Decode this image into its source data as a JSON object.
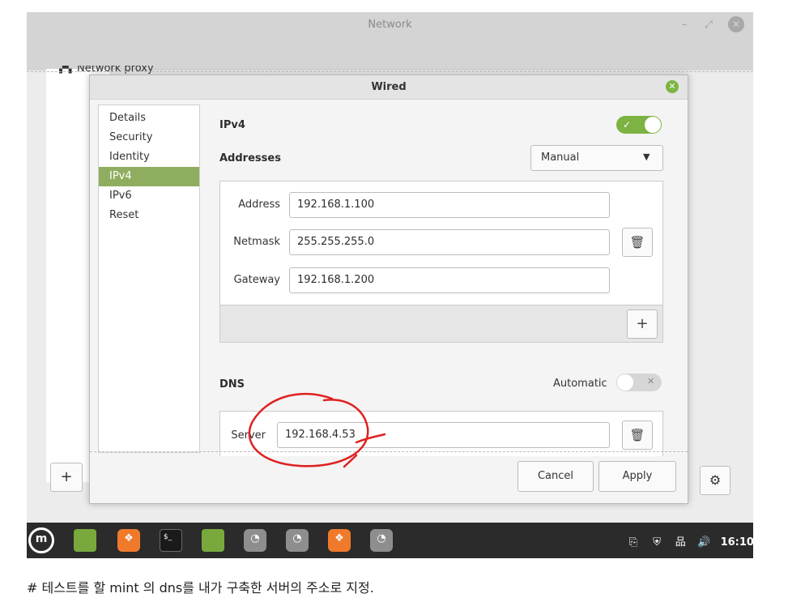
{
  "network_window": {
    "title": "Network",
    "proxy_label": "Network proxy",
    "minimize_glyph": "–",
    "maximize_glyph": "⤢",
    "close_glyph": "✕",
    "add_glyph": "+",
    "gear_glyph": "⚙"
  },
  "wired_dialog": {
    "title": "Wired",
    "close_glyph": "✕",
    "nav": [
      "Details",
      "Security",
      "Identity",
      "IPv4",
      "IPv6",
      "Reset"
    ],
    "active_nav": "IPv4",
    "ipv4_label": "IPv4",
    "ipv4_enabled": true,
    "ipv4_toggle_glyph": "✓",
    "addresses_label": "Addresses",
    "method": {
      "selected": "Manual",
      "caret": "▼"
    },
    "address": {
      "label": "Address",
      "value": "192.168.1.100"
    },
    "netmask": {
      "label": "Netmask",
      "value": "255.255.255.0"
    },
    "gateway": {
      "label": "Gateway",
      "value": "192.168.1.200"
    },
    "delete_glyph": "🗑",
    "add_glyph": "+",
    "dns_label": "DNS",
    "dns_automatic_label": "Automatic",
    "dns_automatic_enabled": false,
    "dns_toggle_glyph": "✕",
    "dns_server": {
      "label": "Server",
      "value": "192.168.4.53"
    },
    "cancel_label": "Cancel",
    "apply_label": "Apply"
  },
  "annotation_color": "#e02020",
  "accent_color": "#7cb342",
  "taskbar": {
    "mint_glyph": "m",
    "fox_glyph": "❖",
    "term_glyph": "$_",
    "wifi_glyph": "◔",
    "tray": [
      "⎘",
      "⛨",
      "品",
      "🔊"
    ],
    "clock": "16:10"
  },
  "caption": "# 테스트를 할 mint 의 dns를 내가 구축한 서버의 주소로 지정."
}
